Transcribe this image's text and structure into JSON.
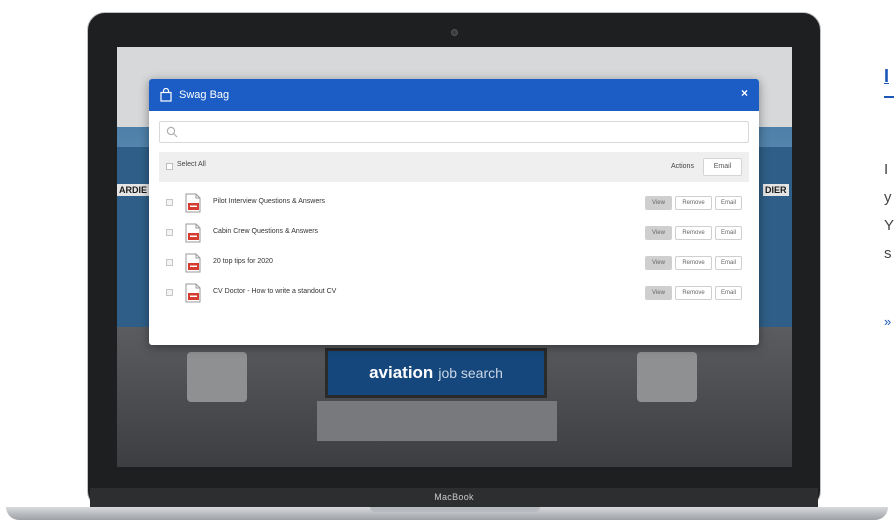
{
  "side": {
    "heading": "I",
    "lines": [
      "I",
      "y",
      "Y",
      "s"
    ],
    "link": "»"
  },
  "device": {
    "label": "MacBook"
  },
  "background": {
    "booth_left_label": "ARDIE",
    "booth_right_label": "DIER",
    "sign_brand": "aviation",
    "sign_sub": "job search"
  },
  "modal": {
    "title": "Swag Bag",
    "close_label": "×",
    "search": {
      "placeholder": "",
      "value": ""
    },
    "select_all_label": "Select All",
    "actions_label": "Actions",
    "toolbar_email_label": "Email",
    "items": [
      {
        "title": "Pilot Interview Questions & Answers",
        "view": "View",
        "remove": "Remove",
        "email": "Email"
      },
      {
        "title": "Cabin Crew Questions & Answers",
        "view": "View",
        "remove": "Remove",
        "email": "Email"
      },
      {
        "title": "20 top tips for 2020",
        "view": "View",
        "remove": "Remove",
        "email": "Email"
      },
      {
        "title": "CV Doctor - How to write a standout CV",
        "view": "View",
        "remove": "Remove",
        "email": "Email"
      }
    ]
  },
  "colors": {
    "header": "#1b5dc4",
    "link": "#1b57b8",
    "pdf_red": "#d63b2f"
  }
}
